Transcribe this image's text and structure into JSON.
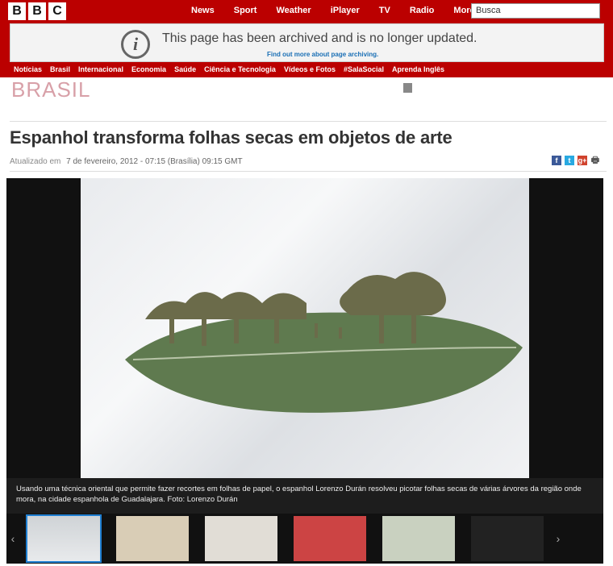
{
  "header": {
    "logo": [
      "B",
      "B",
      "C"
    ],
    "nav": [
      "News",
      "Sport",
      "Weather",
      "iPlayer",
      "TV",
      "Radio",
      "More"
    ],
    "search_placeholder": "Busca"
  },
  "archive": {
    "message": "This page has been archived and is no longer updated.",
    "link": "Find out more about page archiving."
  },
  "section_nav": [
    "Notícias",
    "Brasil",
    "Internacional",
    "Economia",
    "Saúde",
    "Ciência e Tecnologia",
    "Vídeos e Fotos",
    "#SalaSocial",
    "Aprenda Inglês"
  ],
  "brand": "BRASIL",
  "article": {
    "headline": "Espanhol transforma folhas secas em objetos de arte",
    "updated_label": "Atualizado em",
    "updated_value": "7 de fevereiro, 2012 - 07:15 (Brasília) 09:15 GMT"
  },
  "share": {
    "facebook": "f",
    "twitter": "t",
    "gplus": "g+",
    "print": "🖶"
  },
  "gallery": {
    "caption": "Usando uma técnica oriental que permite fazer recortes em folhas de papel, o espanhol Lorenzo Durán resolveu picotar folhas secas de várias árvores da região onde mora, na cidade espanhola de Guadalajara. Foto: Lorenzo Durán",
    "prev": "‹",
    "next": "›"
  },
  "colors": {
    "bbc_red": "#bb0000",
    "headline": "#333333",
    "link": "#1a6fb5"
  }
}
